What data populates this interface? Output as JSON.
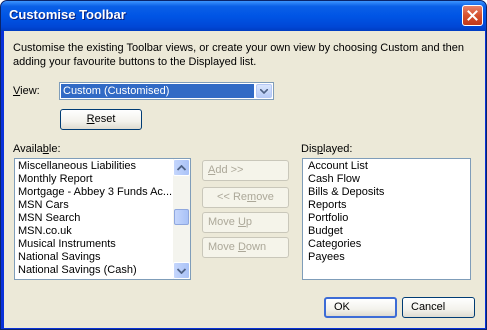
{
  "window": {
    "title": "Customise Toolbar",
    "description": "Customise the existing Toolbar views, or create your own view by choosing Custom and then adding your favourite buttons to the Displayed list."
  },
  "view": {
    "label": "View:",
    "selected": "Custom (Customised)",
    "reset_label": "Reset"
  },
  "available": {
    "label": "Available:",
    "items": [
      "Miscellaneous Liabilities",
      "Monthly Report",
      "Mortgage - Abbey 3 Funds Ac...",
      "MSN Cars",
      "MSN Search",
      "MSN.co.uk",
      "Musical Instruments",
      "National Savings",
      "National Savings (Cash)"
    ]
  },
  "actions": {
    "add": "Add >>",
    "remove": "<< Remove",
    "move_up": "Move Up",
    "move_down": "Move Down"
  },
  "displayed": {
    "label": "Displayed:",
    "items": [
      "Account List",
      "Cash Flow",
      "Bills & Deposits",
      "Reports",
      "Portfolio",
      "Budget",
      "Categories",
      "Payees"
    ]
  },
  "footer": {
    "ok": "OK",
    "cancel": "Cancel"
  }
}
